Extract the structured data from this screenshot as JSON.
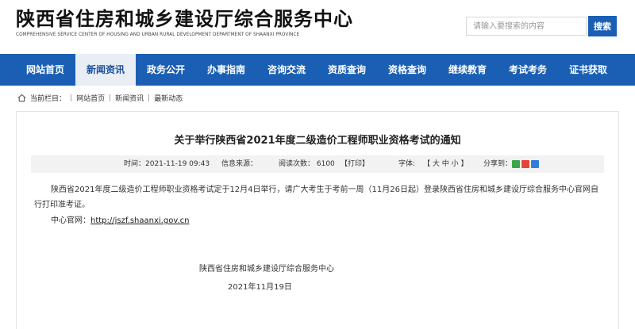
{
  "header": {
    "org_name": "陕西省住房和城乡建设厅综合服务中心",
    "org_name_en": "COMPREHENSIVE SERVICE CENTER OF HOUSING AND URBAN RURAL DEVELOPMENT DEPARTMENT OF SHAANXI PROVINCE",
    "search_placeholder": "请输入要搜索的内容",
    "search_button": "搜索"
  },
  "nav": {
    "items": [
      "网站首页",
      "新闻资讯",
      "政务公开",
      "办事指南",
      "咨询交流",
      "资质查询",
      "资格查询",
      "继续教育",
      "考试考务",
      "证书获取"
    ],
    "active_index": 1
  },
  "breadcrumb": {
    "prefix": "当前栏目：",
    "items": [
      "网站首页",
      "新闻资讯",
      "最新动态"
    ],
    "separator": "|"
  },
  "article": {
    "title": "关于举行陕西省2021年度二级造价工程师职业资格考试的通知",
    "meta": {
      "time": "时间：2021-11-19 09:43",
      "source": "信息来源：",
      "views": "阅读次数：  6100",
      "print": "【打印】",
      "font_label": "字体:",
      "font_sizes": "【  大   中   小  】",
      "share_label": "分享到："
    },
    "body": "陕西省2021年度二级造价工程师职业资格考试定于12月4日举行，请广大考生于考前一周（11月26日起）登录陕西省住房和城乡建设厅综合服务中心官网自行打印准考证。",
    "site_label": "中心官网：",
    "site_url": "http://jszf.shaanxi.gov.cn",
    "sign_org": "陕西省住房和城乡建设厅综合服务中心",
    "sign_date": "2021年11月19日"
  },
  "icons": {
    "home": "home-icon",
    "share": [
      "wechat-icon",
      "weibo-icon",
      "more-share-icon"
    ]
  },
  "colors": {
    "primary": "#1a5fb4",
    "nav_active_bg": "#e9eef5",
    "meta_bg": "#f2f2f2"
  }
}
